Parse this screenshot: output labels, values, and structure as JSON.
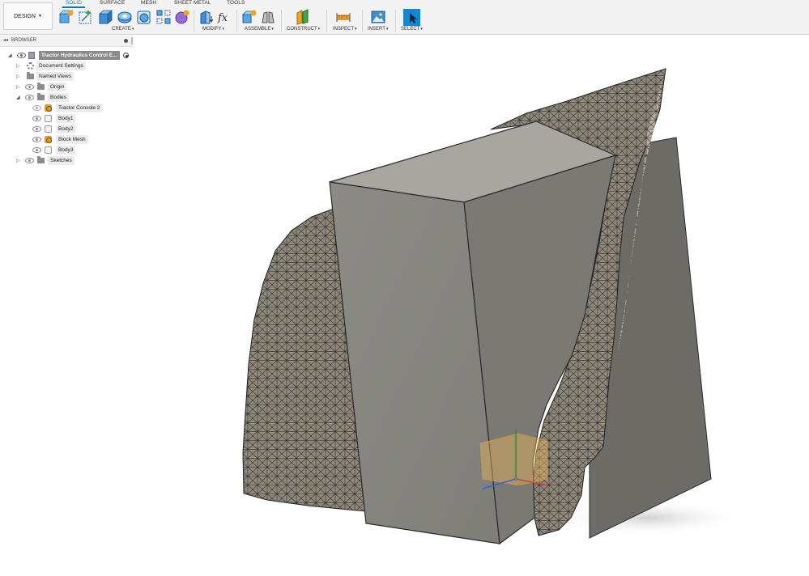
{
  "workspace": {
    "label": "DESIGN"
  },
  "tabs": [
    {
      "label": "SOLID",
      "active": true
    },
    {
      "label": "SURFACE",
      "active": false
    },
    {
      "label": "MESH",
      "active": false
    },
    {
      "label": "SHEET METAL",
      "active": false
    },
    {
      "label": "TOOLS",
      "active": false
    }
  ],
  "tool_groups": [
    {
      "label": "CREATE",
      "tools": [
        "new-component-icon",
        "create-sketch-icon",
        "extrude-icon",
        "revolve-icon",
        "sweep-icon",
        "pattern-icon",
        "create-form-icon"
      ]
    },
    {
      "label": "MODIFY",
      "tools": [
        "press-pull-icon",
        "parameters-icon"
      ]
    },
    {
      "label": "ASSEMBLE",
      "tools": [
        "new-component-assemble-icon",
        "joint-icon"
      ]
    },
    {
      "label": "CONSTRUCT",
      "tools": [
        "offset-plane-icon"
      ]
    },
    {
      "label": "INSPECT",
      "tools": [
        "measure-icon"
      ]
    },
    {
      "label": "INSERT",
      "tools": [
        "insert-image-icon"
      ]
    },
    {
      "label": "SELECT",
      "tools": [
        "select-icon"
      ]
    }
  ],
  "browser": {
    "title": "BROWSER",
    "root_label": "Tractor Hydraulics Control E...",
    "items": [
      {
        "label": "Document Settings",
        "icon": "gear-icon"
      },
      {
        "label": "Named Views",
        "icon": "folder-icon"
      },
      {
        "label": "Origin",
        "icon": "folder-icon"
      },
      {
        "label": "Bodies",
        "icon": "folder-icon",
        "expanded": true
      },
      {
        "label": "Tractor Console 2",
        "icon": "mesh-body-icon"
      },
      {
        "label": "Body1",
        "icon": "body-icon"
      },
      {
        "label": "Body2",
        "icon": "body-icon"
      },
      {
        "label": "Block Mesh",
        "icon": "mesh-body-icon"
      },
      {
        "label": "Body3",
        "icon": "body-icon"
      },
      {
        "label": "Sketches",
        "icon": "folder-icon"
      }
    ]
  },
  "colors": {
    "accent": "#0a77c2",
    "solid_front": "#878681",
    "solid_top": "#a7a59e",
    "solid_right": "#6f6e69",
    "mesh_fill": "#8e877c",
    "mesh_line": "#2a2823"
  }
}
